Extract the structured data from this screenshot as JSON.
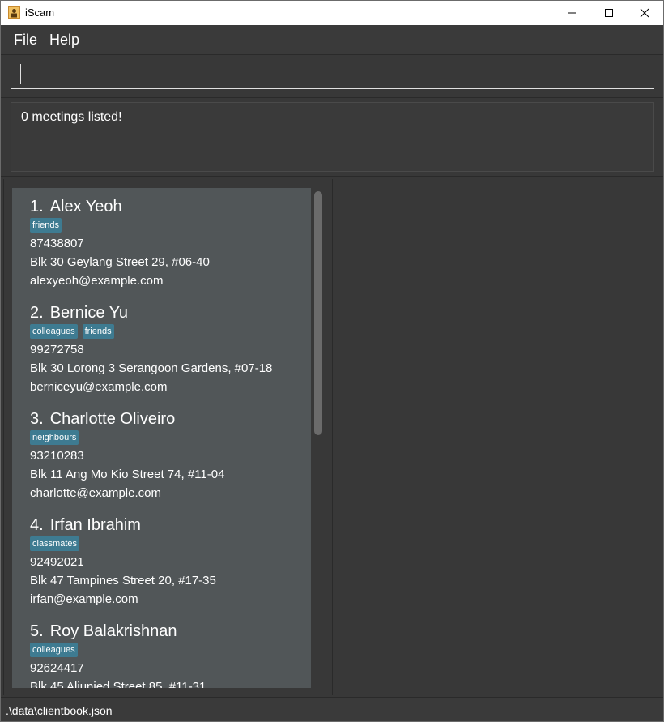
{
  "window": {
    "title": "iScam",
    "icon": "app-icon"
  },
  "menu": {
    "items": [
      {
        "label": "File"
      },
      {
        "label": "Help"
      }
    ]
  },
  "command": {
    "value": "",
    "placeholder": ""
  },
  "result": {
    "text": "0 meetings listed!"
  },
  "clients": [
    {
      "index": "1.",
      "name": "Alex Yeoh",
      "tags": [
        "friends"
      ],
      "phone": "87438807",
      "address": "Blk 30 Geylang Street 29, #06-40",
      "email": "alexyeoh@example.com"
    },
    {
      "index": "2.",
      "name": "Bernice Yu",
      "tags": [
        "colleagues",
        "friends"
      ],
      "phone": "99272758",
      "address": "Blk 30 Lorong 3 Serangoon Gardens, #07-18",
      "email": "berniceyu@example.com"
    },
    {
      "index": "3.",
      "name": "Charlotte Oliveiro",
      "tags": [
        "neighbours"
      ],
      "phone": "93210283",
      "address": "Blk 11 Ang Mo Kio Street 74, #11-04",
      "email": "charlotte@example.com"
    },
    {
      "index": "4.",
      "name": "Irfan Ibrahim",
      "tags": [
        "classmates"
      ],
      "phone": "92492021",
      "address": "Blk 47 Tampines Street 20, #17-35",
      "email": "irfan@example.com"
    },
    {
      "index": "5.",
      "name": "Roy Balakrishnan",
      "tags": [
        "colleagues"
      ],
      "phone": "92624417",
      "address": "Blk 45 Aljunied Street 85, #11-31",
      "email": ""
    }
  ],
  "status": {
    "path": ".\\data\\clientbook.json"
  },
  "colors": {
    "tag": "#3e7b91",
    "card_bg": "#515658",
    "window_bg": "#383838"
  }
}
